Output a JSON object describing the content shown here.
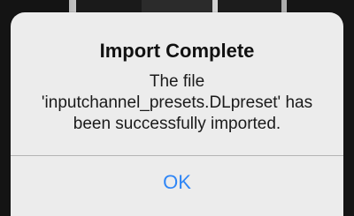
{
  "alert": {
    "title": "Import Complete",
    "message_lines": [
      "The file",
      "'inputchannel_presets.DLpreset' has",
      "been successfully imported."
    ],
    "ok_label": "OK"
  },
  "colors": {
    "dialog_background": "#ececec",
    "button_text": "#2f86f6",
    "divider": "#b4b4b4"
  }
}
